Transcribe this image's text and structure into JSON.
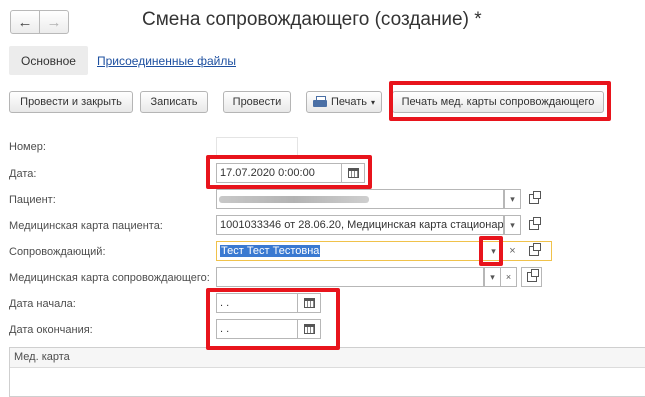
{
  "window": {
    "title": "Смена сопровождающего (создание) *",
    "nav_back": "←",
    "nav_forward": "→"
  },
  "tabs": [
    {
      "label": "Основное",
      "active": true
    },
    {
      "label": "Присоединенные файлы",
      "active": false
    }
  ],
  "toolbar": {
    "post_close": "Провести и закрыть",
    "save": "Записать",
    "post": "Провести",
    "print": "Печать",
    "print_card": "Печать мед. карты сопровождающего"
  },
  "form": {
    "number": {
      "label": "Номер:",
      "value": ""
    },
    "date": {
      "label": "Дата:",
      "value": "17.07.2020  0:00:00"
    },
    "patient": {
      "label": "Пациент:",
      "value": ""
    },
    "patient_card": {
      "label": "Медицинская карта пациента:",
      "value": "1001033346 от 28.06.20, Медицинская карта стационарн"
    },
    "companion": {
      "label": "Сопровождающий:",
      "value": "Тест Тест Тестовна"
    },
    "companion_card": {
      "label": "Медицинская карта сопровождающего:",
      "value": ""
    },
    "start_date": {
      "label": "Дата начала:",
      "value": " .  ."
    },
    "end_date": {
      "label": "Дата окончания:",
      "value": " .  ."
    }
  },
  "panel": {
    "title": "Мед. карта"
  },
  "icons": {
    "dropdown": "▾",
    "clear": "×"
  },
  "colors": {
    "highlight_red": "#e8141c",
    "link_blue": "#1e50a0",
    "selection_blue": "#3a79d1",
    "focus_border": "#f0c24b"
  }
}
